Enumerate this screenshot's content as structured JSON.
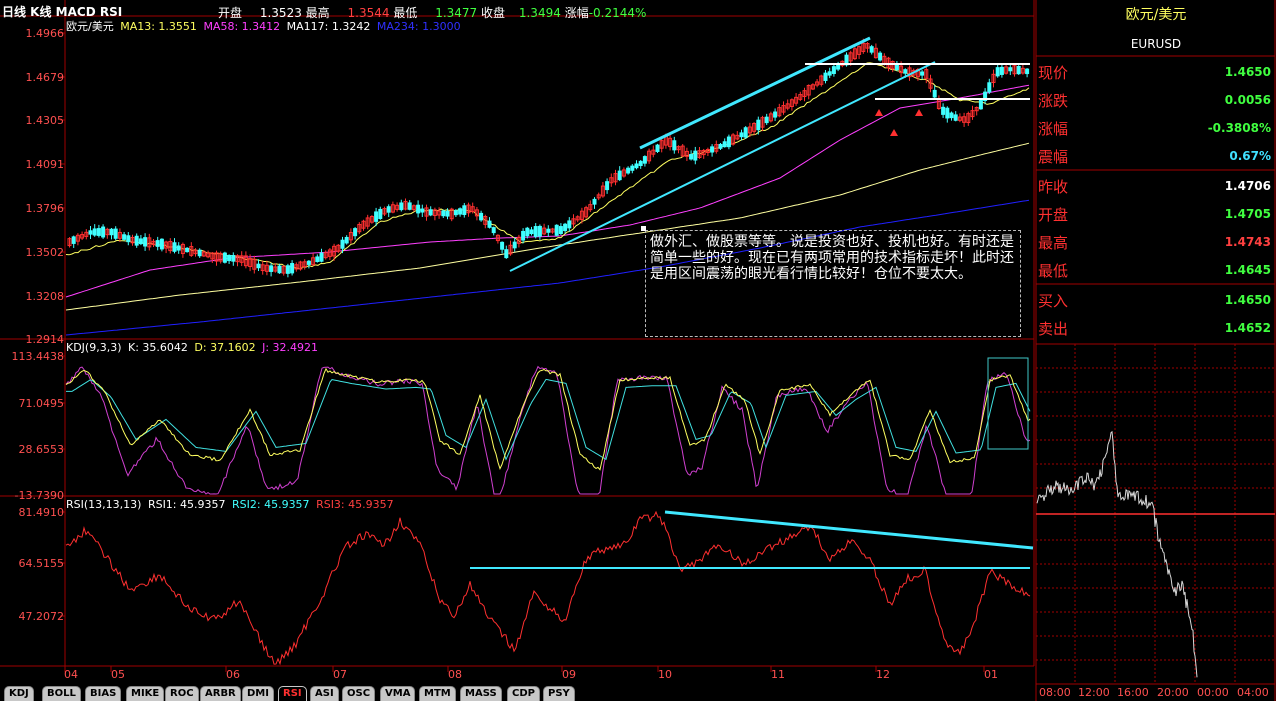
{
  "header": {
    "title": "日线 K线 MACD RSI",
    "open_label": "开盘",
    "open_value": "1.3523",
    "high_label": "最高",
    "high_value": "1.3544",
    "low_label": "最低",
    "low_value": "1.3477",
    "close_label": "收盘",
    "close_value": "1.3494",
    "change_label": "涨幅",
    "change_value": "-0.2144%"
  },
  "price_panel": {
    "symbol_label": "欧元/美元",
    "ma13": "MA13: 1.3551",
    "ma58": "MA58: 1.3412",
    "ma117": "MA117: 1.3242",
    "ma234": "MA234: 1.3000",
    "y_ticks": [
      "1.4966",
      "1.4679",
      "1.4305",
      "1.4091",
      "1.3796",
      "1.3502",
      "1.3208",
      "1.2914"
    ]
  },
  "kdj_panel": {
    "label": "KDJ(9,3,3)",
    "k": "K: 35.6042",
    "d": "D: 37.1602",
    "j": "J: 32.4921",
    "y_ticks": [
      "113.4438",
      "71.0495",
      "28.6553",
      "-13.7390"
    ]
  },
  "rsi_panel": {
    "label": "RSI(13,13,13)",
    "rsi1": "RSI1: 45.9357",
    "rsi2": "RSI2: 45.9357",
    "rsi3": "RSI3: 45.9357",
    "y_ticks": [
      "81.4910",
      "64.5155",
      "47.2072"
    ]
  },
  "x_axis": [
    "04",
    "05",
    "06",
    "07",
    "08",
    "09",
    "10",
    "11",
    "12",
    "01"
  ],
  "annotation": "做外汇、做股票等等。说是投资也好、投机也好。有时还是简单一些的好。现在已有两项常用的技术指标走坏！此时还是用区间震荡的眼光看行情比较好！仓位不要太大。",
  "tabs": [
    "KDJ",
    "BOLL",
    "BIAS",
    "MIKE",
    "ROC",
    "ARBR",
    "DMI",
    "RSI",
    "ASI",
    "OSC",
    "VMA",
    "MTM",
    "MASS",
    "CDP",
    "PSY"
  ],
  "active_tab": "RSI",
  "quote": {
    "title": "欧元/美元",
    "code": "EURUSD",
    "rows": [
      {
        "label": "现价",
        "value": "1.4650",
        "color": "#40ff40"
      },
      {
        "label": "涨跌",
        "value": "0.0056",
        "color": "#40ff40"
      },
      {
        "label": "涨幅",
        "value": "-0.3808%",
        "color": "#40ff40"
      },
      {
        "label": "震幅",
        "value": "0.67%",
        "color": "#40e0ff"
      },
      {
        "label": "昨收",
        "value": "1.4706",
        "color": "#ffffff"
      },
      {
        "label": "开盘",
        "value": "1.4705",
        "color": "#40ff40"
      },
      {
        "label": "最高",
        "value": "1.4743",
        "color": "#ff4040"
      },
      {
        "label": "最低",
        "value": "1.4645",
        "color": "#40ff40"
      },
      {
        "label": "买入",
        "value": "1.4650",
        "color": "#40ff40"
      },
      {
        "label": "卖出",
        "value": "1.4652",
        "color": "#40ff40"
      }
    ]
  },
  "intraday_x": [
    "08:00",
    "12:00",
    "16:00",
    "20:00",
    "00:00",
    "04:00"
  ],
  "colors": {
    "up": "#ff3030",
    "down": "#40ffff",
    "ma13": "#ffff60",
    "ma58": "#ff40ff",
    "ma117": "#ffffa0",
    "ma234": "#2020ff",
    "trend": "#40e8ff",
    "grid": "#a00000"
  }
}
